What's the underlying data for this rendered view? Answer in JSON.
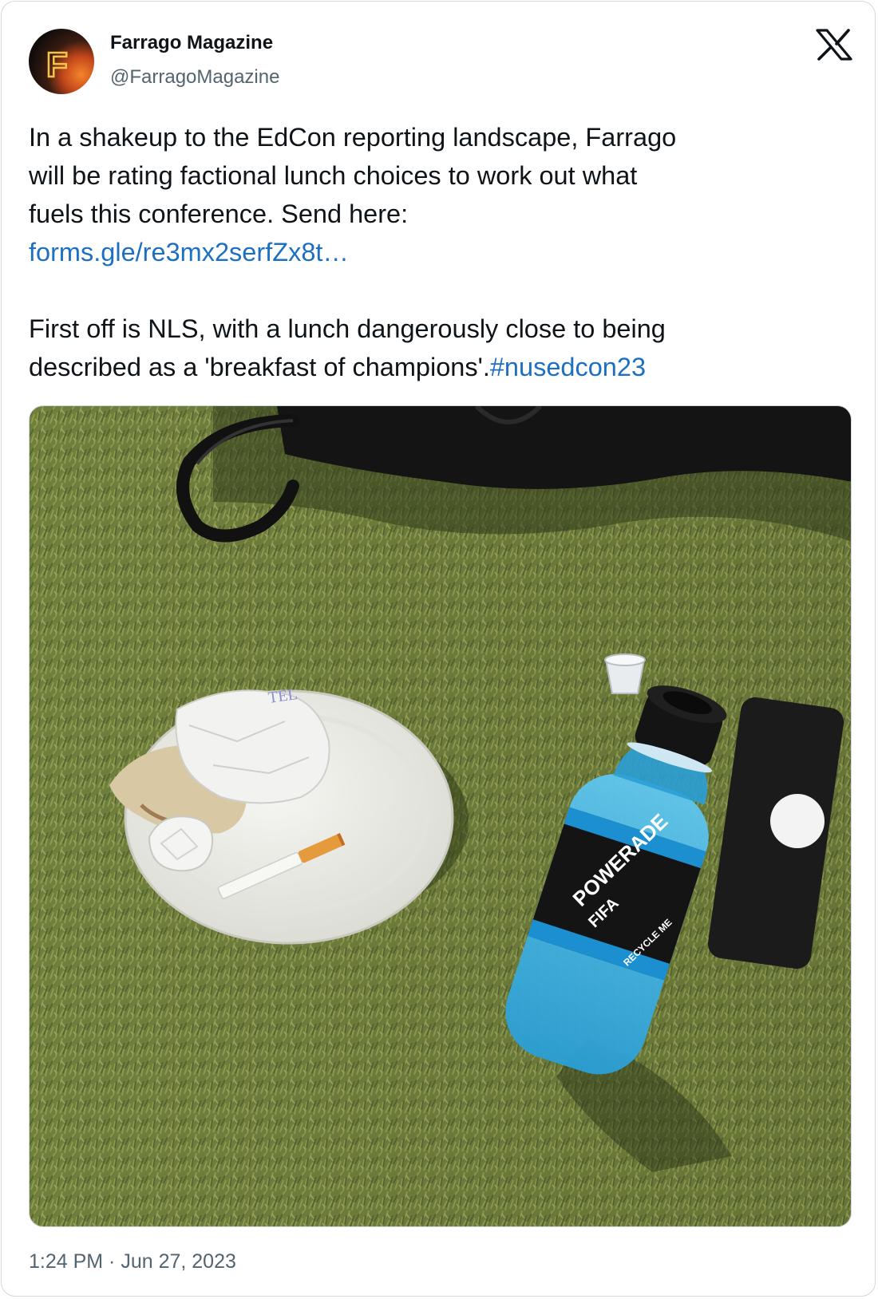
{
  "author": {
    "name": "Farrago Magazine",
    "handle": "@FarragoMagazine",
    "avatar_letter": "F",
    "avatar_colors": {
      "glow": "#f06a1d",
      "dark": "#1a1410",
      "letter": "#f2c44a"
    }
  },
  "platform": {
    "logo_icon": "x-logo-icon"
  },
  "tweet": {
    "lines": [
      "In a shakeup to the EdCon reporting landscape, Farrago",
      "will be rating factional lunch choices to work out what",
      "fuels this conference. Send here:"
    ],
    "link_text": "forms.gle/re3mx2serfZx8t…",
    "second_para_line1": "First off is NLS, with a lunch dangerously close to being",
    "second_para_line2": "described as a 'breakfast of champions'.",
    "hashtag": "#nusedcon23"
  },
  "media": {
    "plate_stamp_text": "TEL",
    "bottle_brand": "POWERADE",
    "bottle_sub": "FIFA",
    "bottle_side": "RECYCLE ME"
  },
  "meta": {
    "timestamp": "1:24 PM · Jun 27, 2023"
  },
  "colors": {
    "link": "#1d6fc1",
    "secondary_text": "#536471",
    "border": "#cfd9de"
  }
}
